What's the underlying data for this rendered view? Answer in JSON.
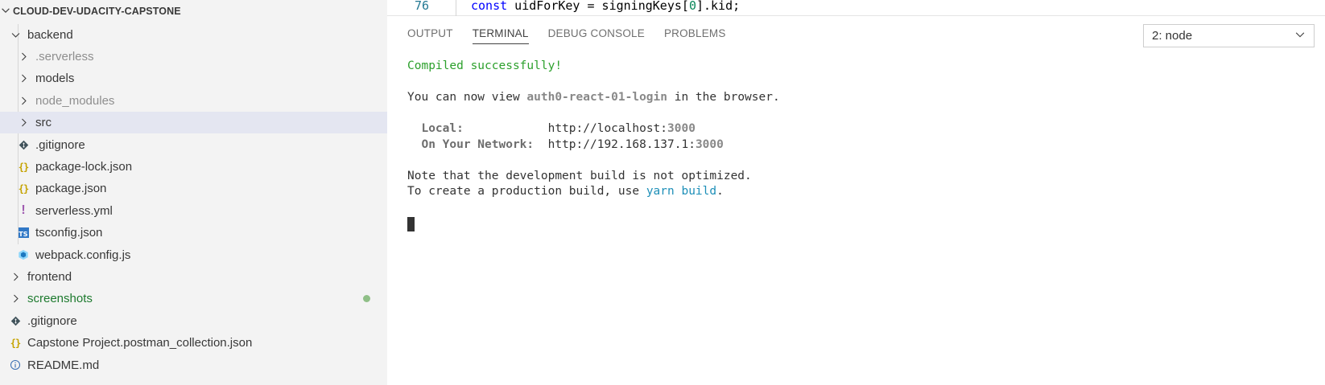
{
  "explorer": {
    "section_title": "CLOUD-DEV-UDACITY-CAPSTONE",
    "items": [
      {
        "label": "backend",
        "kind": "folder-open",
        "depth": 0
      },
      {
        "label": ".serverless",
        "kind": "folder",
        "depth": 1,
        "dim": true
      },
      {
        "label": "models",
        "kind": "folder",
        "depth": 1
      },
      {
        "label": "node_modules",
        "kind": "folder",
        "depth": 1,
        "dim": true
      },
      {
        "label": "src",
        "kind": "folder",
        "depth": 1,
        "selected": true
      },
      {
        "label": ".gitignore",
        "kind": "git",
        "depth": 1
      },
      {
        "label": "package-lock.json",
        "kind": "json",
        "depth": 1
      },
      {
        "label": "package.json",
        "kind": "json",
        "depth": 1
      },
      {
        "label": "serverless.yml",
        "kind": "yml",
        "depth": 1
      },
      {
        "label": "tsconfig.json",
        "kind": "ts",
        "depth": 1
      },
      {
        "label": "webpack.config.js",
        "kind": "webpack",
        "depth": 1
      },
      {
        "label": "frontend",
        "kind": "folder",
        "depth": 0
      },
      {
        "label": "screenshots",
        "kind": "folder",
        "depth": 0,
        "green": true,
        "modified": true
      },
      {
        "label": ".gitignore",
        "kind": "git",
        "depth": 0
      },
      {
        "label": "Capstone Project.postman_collection.json",
        "kind": "json",
        "depth": 0
      },
      {
        "label": "README.md",
        "kind": "info",
        "depth": 0
      }
    ]
  },
  "editor": {
    "line_number": "76",
    "code_keyword": "const",
    "code_pre": " uidForKey = signingKeys[",
    "code_num": "0",
    "code_post": "].kid;"
  },
  "panel": {
    "tabs": [
      {
        "label": "OUTPUT",
        "active": false
      },
      {
        "label": "TERMINAL",
        "active": true
      },
      {
        "label": "DEBUG CONSOLE",
        "active": false
      },
      {
        "label": "PROBLEMS",
        "active": false
      }
    ],
    "terminal_selector": "2: node"
  },
  "terminal": {
    "compiled": "Compiled successfully!",
    "view_pre": "You can now view ",
    "app_name": "auth0-react-01-login",
    "view_post": " in the browser.",
    "local_label": "  Local:            ",
    "local_url": "http://localhost:",
    "local_port": "3000",
    "network_label": "  On Your Network:  ",
    "network_url": "http://192.168.137.1:",
    "network_port": "3000",
    "note": "Note that the development build is not optimized.",
    "prod_pre": "To create a production build, use ",
    "prod_cmd": "yarn build",
    "prod_post": "."
  },
  "colors": {
    "sidebar_bg": "#f3f3f3",
    "selected_row": "#e4e6f1",
    "success_green": "#2ca02c",
    "command_blue": "#1d8fb8"
  }
}
